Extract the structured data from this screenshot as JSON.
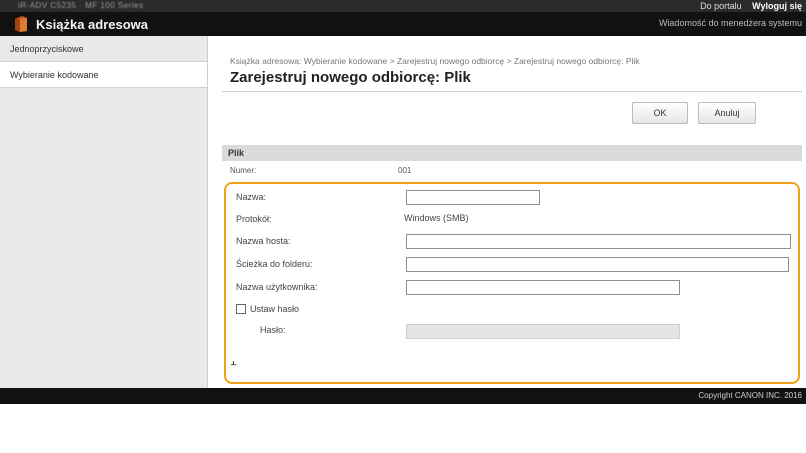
{
  "topbar": {
    "device_name": "iR-ADV C5235 · MF 100 Series",
    "portal_link": "Do portalu",
    "logout_link": "Wyloguj się"
  },
  "header": {
    "app_title": "Książka adresowa",
    "admin_message": "Wiadomość do menedżera systemu"
  },
  "sidebar": {
    "items": [
      {
        "label": "Jednoprzyciskowe",
        "active": false
      },
      {
        "label": "Wybieranie kodowane",
        "active": true
      }
    ]
  },
  "main": {
    "breadcrumb": "Książka adresowa: Wybieranie kodowane > Zarejestruj nowego odbiorcę > Zarejestruj nowego odbiorcę: Plik",
    "title": "Zarejestruj nowego odbiorcę: Plik",
    "ok_label": "OK",
    "cancel_label": "Anuluj",
    "section_title": "Plik",
    "number_label": "Numer:",
    "number_value": "001"
  },
  "form": {
    "name_label": "Nazwa:",
    "name_value": "",
    "protocol_label": "Protokół:",
    "protocol_value": "Windows (SMB)",
    "host_label": "Nazwa hosta:",
    "host_value": "",
    "folder_label": "Ścieżka do folderu:",
    "folder_value": "",
    "user_label": "Nazwa użytkownika:",
    "user_value": "",
    "set_password_label": "Ustaw hasło",
    "set_password_checked": false,
    "password_label": "Hasło:",
    "password_value": ""
  },
  "footer": {
    "copyright": "Copyright CANON INC. 2016"
  },
  "colors": {
    "highlight": "#f0a21c",
    "header_bg": "#111111",
    "sidebar_bg": "#e9e9e9"
  }
}
